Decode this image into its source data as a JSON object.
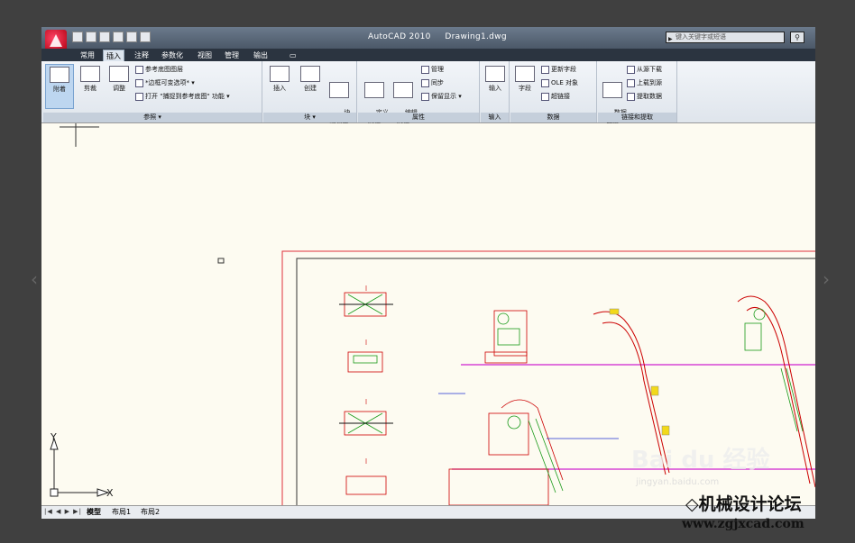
{
  "window": {
    "title": "AutoCAD 2010     Drawing1.dwg",
    "search_placeholder": "键入关键字或短语"
  },
  "menu_tabs": [
    "常用",
    "插入",
    "注释",
    "参数化",
    "视图",
    "管理",
    "输出"
  ],
  "active_tab": "插入",
  "ribbon": {
    "reference": {
      "title": "参照 ▾",
      "attach": "附着",
      "clip": "剪裁",
      "adjust": "调整",
      "underlay_layers": "参考底图图层",
      "frames_variable": "*边框可变选项*",
      "snap_underlay": "打开 \"捕捉到参考底图\" 功能"
    },
    "block": {
      "title": "块 ▾",
      "insert": "插入",
      "create": "创建",
      "block_editor": "块\n编辑器"
    },
    "attributes": {
      "title": "属性",
      "define": "定义\n属性",
      "edit": "编辑\n属性",
      "manage": "管理",
      "sync": "同步",
      "retain_display": "保留显示"
    },
    "import": {
      "title": "输入",
      "import": "输入"
    },
    "data": {
      "title": "数据",
      "field": "字段",
      "update_fields": "更新字段",
      "ole_object": "OLE 对象",
      "hyperlink": "超链接"
    },
    "linking": {
      "title": "链接和提取",
      "data_link": "数据\n链接",
      "download_source": "从源下载",
      "upload_source": "上载到源",
      "extract_data": "提取数据"
    }
  },
  "ucs": {
    "x": "X",
    "y": "Y"
  },
  "layout_tabs": [
    "模型",
    "布局1",
    "布局2"
  ],
  "nav_buttons": "|◀ ◀ ▶ ▶|",
  "watermark": {
    "brand": "Bai du 经验",
    "url": "jingyan.baidu.com"
  },
  "site_logo": {
    "name": "◇机械设计论坛",
    "url": "www.zgjxcad.com"
  }
}
